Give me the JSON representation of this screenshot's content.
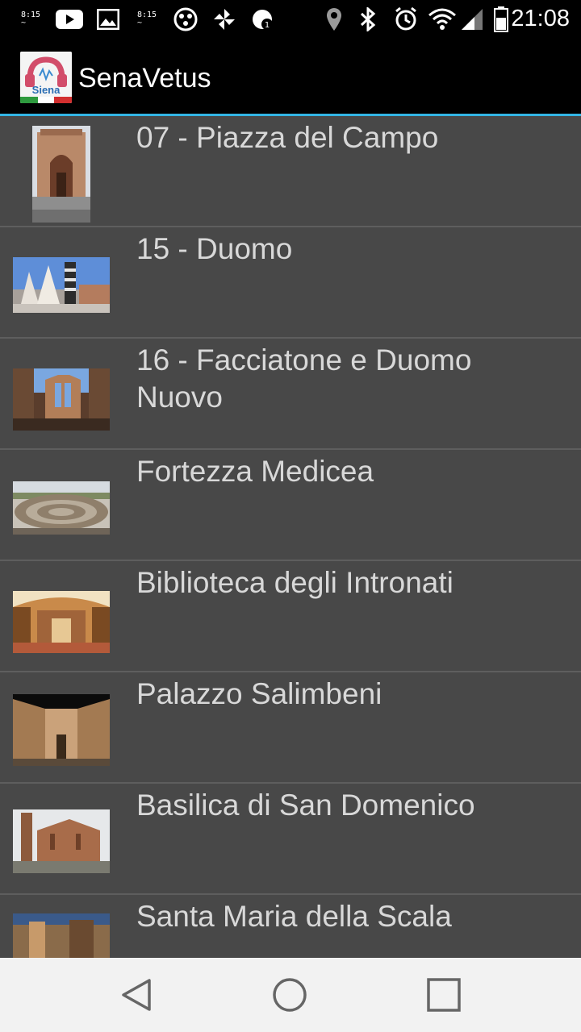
{
  "status_bar": {
    "time": "21:08",
    "stacked_time_a": [
      "8:15",
      "~"
    ],
    "stacked_time_b": [
      "8:15",
      "~"
    ],
    "icons": [
      "youtube-icon",
      "image-icon",
      "clock-widget-icon",
      "radioactive-icon",
      "pinwheel-icon",
      "update-icon",
      "location-icon",
      "bluetooth-icon",
      "alarm-icon",
      "wifi-icon",
      "signal-icon",
      "battery-icon"
    ]
  },
  "app_bar": {
    "title": "SenaVetus",
    "logo_text": "Siena",
    "accent_color": "#33b5e5"
  },
  "list": {
    "items": [
      {
        "label": "07 - Piazza del Campo",
        "thumb": "gothic-tower-photo"
      },
      {
        "label": "15 - Duomo",
        "thumb": "cathedral-photo"
      },
      {
        "label": "16 - Facciatone e Duomo Nuovo",
        "thumb": "facciatone-photo"
      },
      {
        "label": "Fortezza Medicea",
        "thumb": "fortress-photo"
      },
      {
        "label": "Biblioteca degli Intronati",
        "thumb": "library-photo"
      },
      {
        "label": "Palazzo Salimbeni",
        "thumb": "palazzo-photo"
      },
      {
        "label": "Basilica di San Domenico",
        "thumb": "basilica-photo"
      },
      {
        "label": "Santa Maria della Scala",
        "thumb": "santa-maria-photo"
      }
    ]
  },
  "nav_bar": {
    "buttons": [
      "back-icon",
      "home-icon",
      "recents-icon"
    ]
  }
}
